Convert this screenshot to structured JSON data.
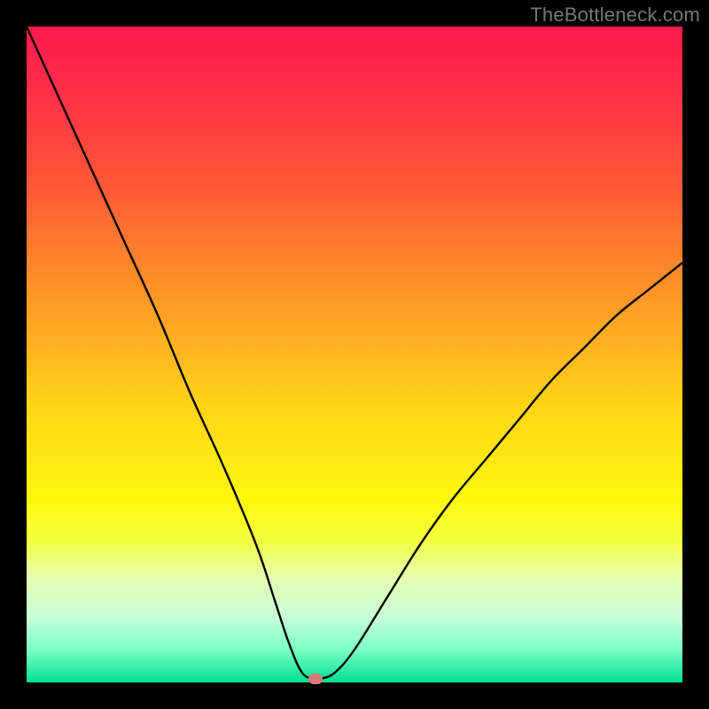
{
  "watermark": "TheBottleneck.com",
  "colors": {
    "curve": "#000000",
    "marker": "#d97a7a",
    "frame": "#000000"
  },
  "chart_data": {
    "type": "line",
    "title": "",
    "xlabel": "",
    "ylabel": "",
    "xlim": [
      0,
      100
    ],
    "ylim": [
      0,
      100
    ],
    "x": [
      0,
      5,
      10,
      15,
      20,
      25,
      30,
      35,
      38,
      40,
      42,
      44,
      45,
      47,
      50,
      55,
      60,
      65,
      70,
      75,
      80,
      85,
      90,
      95,
      100
    ],
    "y": [
      100,
      89,
      78,
      67,
      56,
      44,
      33,
      21,
      12,
      6,
      1.5,
      0.5,
      0.6,
      1.5,
      5,
      13,
      21,
      28,
      34,
      40,
      46,
      51,
      56,
      60,
      64
    ],
    "marker": {
      "x": 44,
      "y": 0.5
    },
    "grid": false,
    "legend": false
  }
}
